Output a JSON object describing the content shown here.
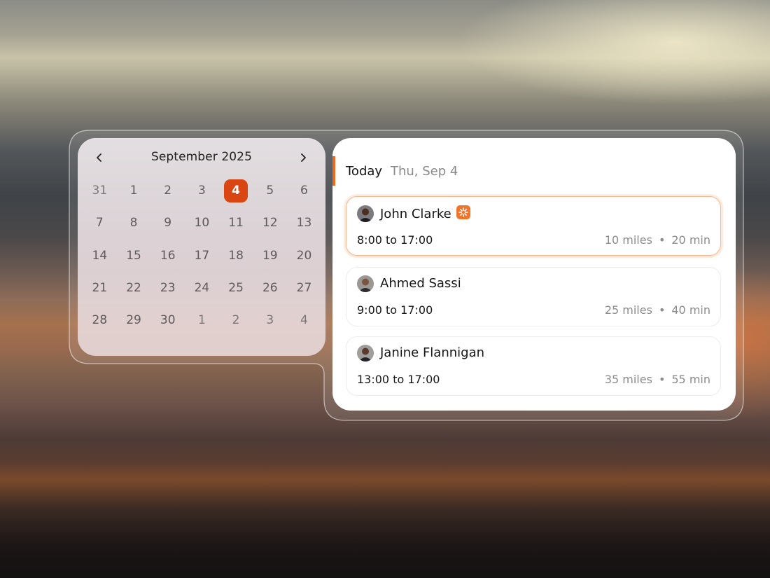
{
  "calendar": {
    "month_title": "September 2025",
    "prev_icon": "chevron-left-icon",
    "next_icon": "chevron-right-icon",
    "selected_day": "4",
    "weeks": [
      [
        "31",
        "1",
        "2",
        "3",
        "4",
        "5",
        "6"
      ],
      [
        "7",
        "8",
        "9",
        "10",
        "11",
        "12",
        "13"
      ],
      [
        "14",
        "15",
        "16",
        "17",
        "18",
        "19",
        "20"
      ],
      [
        "21",
        "22",
        "23",
        "24",
        "25",
        "26",
        "27"
      ],
      [
        "28",
        "29",
        "30",
        "1",
        "2",
        "3",
        "4"
      ]
    ]
  },
  "schedule": {
    "heading": "Today",
    "date": "Thu, Sep 4",
    "entries": [
      {
        "name": "John Clarke",
        "shift": "8:00 to 17:00",
        "distance": "10 miles",
        "duration": "20 min",
        "separator": "•",
        "badge_icon": "sparkle-badge-icon"
      },
      {
        "name": "Ahmed Sassi",
        "shift": "9:00 to 17:00",
        "distance": "25 miles",
        "duration": "40 min",
        "separator": "•"
      },
      {
        "name": "Janine Flannigan",
        "shift": "13:00 to 17:00",
        "distance": "35 miles",
        "duration": "55 min",
        "separator": "•"
      }
    ]
  },
  "colors": {
    "accent": "#ee6a1f",
    "selected_day": "#d94612",
    "active_card_border": "#f6b98f"
  }
}
